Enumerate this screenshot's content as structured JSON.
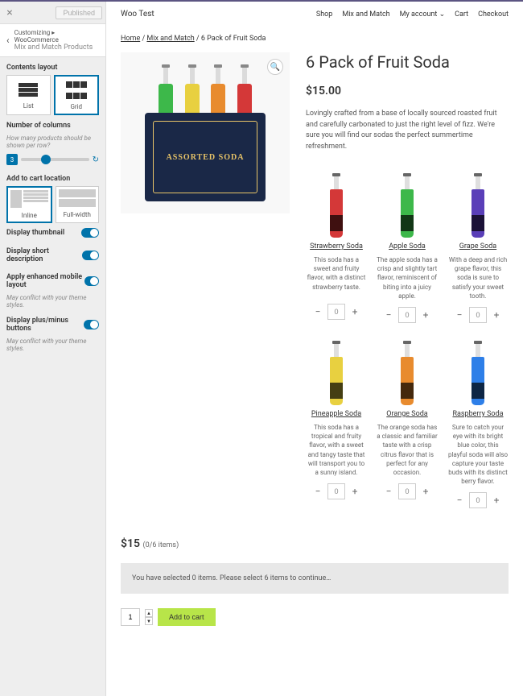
{
  "customizer": {
    "published": "Published",
    "crumb1": "Customizing ▸ WooCommerce",
    "crumb2": "Mix and Match Products",
    "contents_layout": "Contents layout",
    "list": "List",
    "grid": "Grid",
    "num_cols": "Number of columns",
    "num_cols_sub": "How many products should be shown per row?",
    "num_val": "3",
    "add_cart_loc": "Add to cart location",
    "inline": "Inline",
    "fullwidth": "Full-width",
    "t1": "Display thumbnail",
    "t2": "Display short description",
    "t3": "Apply enhanced mobile layout",
    "t3_sub": "May conflict with your theme styles.",
    "t4": "Display plus/minus buttons",
    "t4_sub": "May conflict with your theme styles."
  },
  "site": {
    "title": "Woo Test",
    "nav": {
      "shop": "Shop",
      "mix": "Mix and Match",
      "account": "My account",
      "cart": "Cart",
      "checkout": "Checkout"
    }
  },
  "breadcrumb": {
    "home": "Home",
    "mix": "Mix and Match",
    "current": "6 Pack of Fruit Soda"
  },
  "product": {
    "title": "6 Pack of Fruit Soda",
    "price": "$15.00",
    "desc": "Lovingly crafted from a base of locally sourced roasted fruit and carefully carbonated to just the right level of fizz. We're sure you will find our sodas the perfect summertime refreshment.",
    "box_text": "ASSORTED SODA"
  },
  "variants": [
    {
      "name": "Strawberry Soda",
      "desc": "This soda has a sweet and fruity flavor, with a distinct strawberry taste.",
      "color": "#d43838"
    },
    {
      "name": "Apple Soda",
      "desc": "The apple soda has a crisp and slightly tart flavor, reminiscent of biting into a juicy apple.",
      "color": "#3db84a"
    },
    {
      "name": "Grape Soda",
      "desc": "With a deep and rich grape flavor, this soda is sure to satisfy your sweet tooth.",
      "color": "#5a3fb8"
    },
    {
      "name": "Pineapple Soda",
      "desc": "This soda has a tropical and fruity flavor, with a sweet and tangy taste that will transport you to a sunny island.",
      "color": "#e8d040"
    },
    {
      "name": "Orange Soda",
      "desc": "The orange soda has a classic and familiar taste with a crisp citrus flavor that is perfect for any occasion.",
      "color": "#e88b2e"
    },
    {
      "name": "Raspberry Soda",
      "desc": "Sure to catch your eye with its bright blue color, this playful soda will also capture your taste buds with its distinct berry flavor.",
      "color": "#2e7fe8"
    }
  ],
  "qty_default": "0",
  "total": {
    "price": "$15",
    "items": "(0/6 items)"
  },
  "msg": "You have selected 0 items. Please select 6 items to continue…",
  "cart": {
    "qty": "1",
    "btn": "Add to cart"
  }
}
